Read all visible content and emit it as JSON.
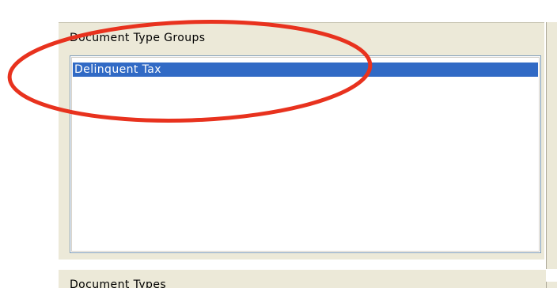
{
  "section": {
    "title": "Document Type Groups"
  },
  "list": {
    "items": [
      {
        "label": "Delinquent Tax",
        "selected": true
      }
    ]
  },
  "next_section": {
    "title": "Document Types"
  },
  "annotation": {
    "shape": "ellipse",
    "color": "#e8321e"
  },
  "colors": {
    "selection": "#316ac5",
    "panel": "#ece9d8",
    "list_border": "#7f9db9"
  }
}
